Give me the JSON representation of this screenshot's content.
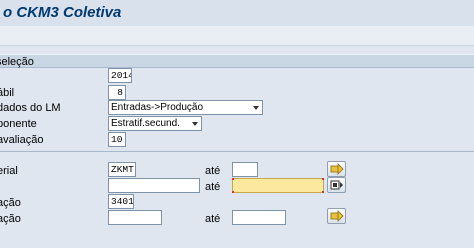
{
  "window": {
    "title": "o CKM3 Coletiva"
  },
  "section": {
    "title": "seleção"
  },
  "fields": {
    "ano": {
      "label": "",
      "value": "2014"
    },
    "periodo": {
      "label": "ábil",
      "value": "8"
    },
    "dados_lm": {
      "label": "dados do LM",
      "value": "Entradas->Produção"
    },
    "componente": {
      "label": "ponente",
      "value": "Estratif.secund."
    },
    "avaliacao": {
      "label": "avaliação",
      "value": "10"
    },
    "material": {
      "label": "erial",
      "value_from": "ZKMT",
      "value_to": ""
    },
    "row2": {
      "label": "",
      "value_from": "",
      "value_to": ""
    },
    "row3": {
      "label": "ação",
      "value_from": "3401"
    },
    "row4": {
      "label": "ação",
      "value_from": "",
      "value_to": ""
    }
  },
  "range_label": "até",
  "icons": {
    "multi_select": "arrow-right-icon",
    "multi_select_active": "multiple-selection-icon"
  },
  "colors": {
    "required_field": "#fde8a0",
    "section_bar": "#c9d6e4",
    "title": "#003a6f"
  }
}
